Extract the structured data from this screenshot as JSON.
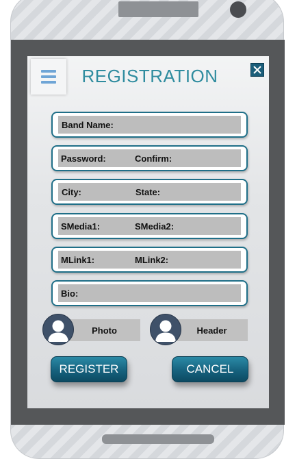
{
  "header": {
    "title": "REGISTRATION"
  },
  "fields": {
    "band_name": {
      "label": "Band Name:",
      "value": ""
    },
    "password": {
      "label": "Password:",
      "value": ""
    },
    "confirm": {
      "label": "Confirm:",
      "value": ""
    },
    "city": {
      "label": "City:",
      "value": ""
    },
    "state": {
      "label": "State:",
      "value": ""
    },
    "smedia1": {
      "label": "SMedia1:",
      "value": ""
    },
    "smedia2": {
      "label": "SMedia2:",
      "value": ""
    },
    "mlink1": {
      "label": "MLink1:",
      "value": ""
    },
    "mlink2": {
      "label": "MLink2:",
      "value": ""
    },
    "bio": {
      "label": "Bio:",
      "value": ""
    }
  },
  "uploads": {
    "photo_label": "Photo",
    "header_label": "Header"
  },
  "buttons": {
    "register": "REGISTER",
    "cancel": "CANCEL"
  },
  "icons": {
    "menu": "hamburger-menu-icon",
    "close": "close-icon",
    "avatar": "user-avatar-icon"
  },
  "colors": {
    "accent": "#1f6f88",
    "title": "#2f8c9f",
    "button": "#16627e",
    "menu_lines": "#6fa5d6"
  }
}
